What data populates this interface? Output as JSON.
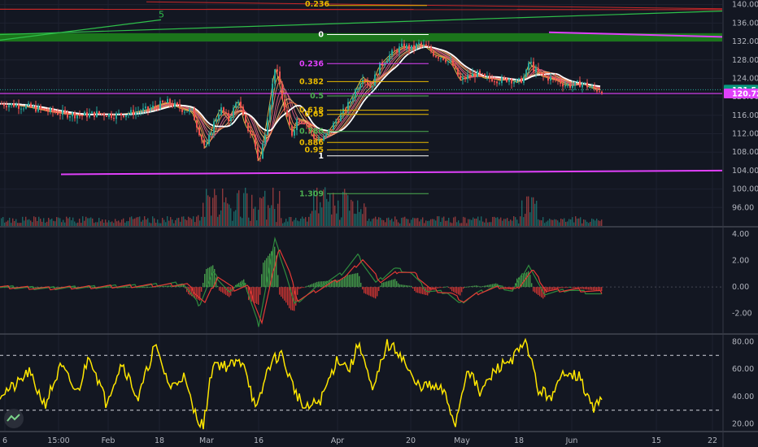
{
  "chart_data": [
    {
      "type": "candlestick",
      "title": "",
      "ylim": [
        92,
        141
      ],
      "y_ticks": [
        "140.00",
        "136.00",
        "132.00",
        "128.00",
        "124.00",
        "120.00",
        "116.00",
        "112.00",
        "108.00",
        "104.00",
        "100.00",
        "96.00"
      ],
      "price_tags": [
        {
          "value": 121.54,
          "label": "121.54",
          "color": "#089981"
        },
        {
          "value": 120.72,
          "label": "120.72",
          "color": "#e040fb"
        }
      ],
      "close_series": [
        {
          "x": 0,
          "y": 118.5
        },
        {
          "x": 20,
          "y": 118.2
        },
        {
          "x": 40,
          "y": 117.6
        },
        {
          "x": 60,
          "y": 116.8
        },
        {
          "x": 80,
          "y": 116.3
        },
        {
          "x": 100,
          "y": 116.0
        },
        {
          "x": 120,
          "y": 116.4
        },
        {
          "x": 140,
          "y": 116.0
        },
        {
          "x": 160,
          "y": 116.5
        },
        {
          "x": 180,
          "y": 117.2
        },
        {
          "x": 195,
          "y": 118.3
        },
        {
          "x": 205,
          "y": 118.8
        },
        {
          "x": 215,
          "y": 118.0
        },
        {
          "x": 225,
          "y": 117.2
        },
        {
          "x": 235,
          "y": 116.8
        },
        {
          "x": 245,
          "y": 112.0
        },
        {
          "x": 252,
          "y": 108.5
        },
        {
          "x": 260,
          "y": 113.5
        },
        {
          "x": 270,
          "y": 117.5
        },
        {
          "x": 280,
          "y": 115.0
        },
        {
          "x": 292,
          "y": 119.5
        },
        {
          "x": 300,
          "y": 114.0
        },
        {
          "x": 310,
          "y": 111.5
        },
        {
          "x": 318,
          "y": 105.5
        },
        {
          "x": 325,
          "y": 112.5
        },
        {
          "x": 332,
          "y": 120.0
        },
        {
          "x": 337,
          "y": 126.5
        },
        {
          "x": 342,
          "y": 123.5
        },
        {
          "x": 350,
          "y": 116.0
        },
        {
          "x": 358,
          "y": 112.0
        },
        {
          "x": 365,
          "y": 115.5
        },
        {
          "x": 375,
          "y": 114.5
        },
        {
          "x": 385,
          "y": 111.0
        },
        {
          "x": 395,
          "y": 110.5
        },
        {
          "x": 405,
          "y": 113.0
        },
        {
          "x": 415,
          "y": 115.5
        },
        {
          "x": 425,
          "y": 117.5
        },
        {
          "x": 435,
          "y": 121.0
        },
        {
          "x": 445,
          "y": 124.5
        },
        {
          "x": 455,
          "y": 122.0
        },
        {
          "x": 465,
          "y": 126.5
        },
        {
          "x": 475,
          "y": 128.5
        },
        {
          "x": 485,
          "y": 130.0
        },
        {
          "x": 495,
          "y": 131.0
        },
        {
          "x": 505,
          "y": 130.5
        },
        {
          "x": 515,
          "y": 131.5
        },
        {
          "x": 525,
          "y": 130.5
        },
        {
          "x": 535,
          "y": 129.0
        },
        {
          "x": 545,
          "y": 128.5
        },
        {
          "x": 555,
          "y": 127.0
        },
        {
          "x": 565,
          "y": 123.5
        },
        {
          "x": 575,
          "y": 124.5
        },
        {
          "x": 585,
          "y": 125.0
        },
        {
          "x": 595,
          "y": 124.0
        },
        {
          "x": 605,
          "y": 124.0
        },
        {
          "x": 615,
          "y": 123.5
        },
        {
          "x": 625,
          "y": 124.0
        },
        {
          "x": 635,
          "y": 123.0
        },
        {
          "x": 645,
          "y": 124.5
        },
        {
          "x": 650,
          "y": 128.0
        },
        {
          "x": 655,
          "y": 126.0
        },
        {
          "x": 665,
          "y": 124.5
        },
        {
          "x": 675,
          "y": 124.0
        },
        {
          "x": 685,
          "y": 123.5
        },
        {
          "x": 695,
          "y": 122.5
        },
        {
          "x": 705,
          "y": 122.5
        },
        {
          "x": 715,
          "y": 123.0
        },
        {
          "x": 725,
          "y": 122.0
        },
        {
          "x": 735,
          "y": 121.5
        },
        {
          "x": 740,
          "y": 121.5
        }
      ],
      "fib_levels": [
        {
          "label": "0",
          "value": 133.5,
          "color": "#ffffff"
        },
        {
          "label": "0.236",
          "value": 127.2,
          "color": "#e040fb"
        },
        {
          "label": "0.382",
          "value": 123.3,
          "color": "#e6b800"
        },
        {
          "label": "0.5",
          "value": 120.2,
          "color": "#4caf50"
        },
        {
          "label": "0.618",
          "value": 117.1,
          "color": "#e6b800"
        },
        {
          "label": "0.65",
          "value": 116.2,
          "color": "#e6b800"
        },
        {
          "label": "0.786",
          "value": 112.5,
          "color": "#4caf50"
        },
        {
          "label": "0.886",
          "value": 110.1,
          "color": "#e6b800"
        },
        {
          "label": "0.95",
          "value": 108.5,
          "color": "#e6b800"
        },
        {
          "label": "1",
          "value": 107.2,
          "color": "#ffffff"
        },
        {
          "label": "1.309",
          "value": 99.0,
          "color": "#4caf50"
        }
      ],
      "top_fib_label": "0.236",
      "wave_label": "5"
    },
    {
      "type": "line",
      "title": "",
      "ylim": [
        -3.5,
        4.5
      ],
      "y_ticks": [
        "4.00",
        "2.00",
        "0.00",
        "-2.00"
      ],
      "series": [
        {
          "values": [
            {
              "x": 0,
              "y": 0.0
            },
            {
              "x": 60,
              "y": -0.1
            },
            {
              "x": 120,
              "y": 0.0
            },
            {
              "x": 180,
              "y": 0.1
            },
            {
              "x": 225,
              "y": 0.3
            },
            {
              "x": 245,
              "y": -1.4
            },
            {
              "x": 262,
              "y": 1.1
            },
            {
              "x": 282,
              "y": -0.4
            },
            {
              "x": 300,
              "y": 0.4
            },
            {
              "x": 318,
              "y": -2.9
            },
            {
              "x": 338,
              "y": 3.6
            },
            {
              "x": 352,
              "y": 0.9
            },
            {
              "x": 362,
              "y": -1.3
            },
            {
              "x": 390,
              "y": 0.0
            },
            {
              "x": 420,
              "y": 1.0
            },
            {
              "x": 440,
              "y": 2.4
            },
            {
              "x": 462,
              "y": 0.3
            },
            {
              "x": 485,
              "y": 1.4
            },
            {
              "x": 505,
              "y": 1.1
            },
            {
              "x": 525,
              "y": -0.3
            },
            {
              "x": 550,
              "y": -0.4
            },
            {
              "x": 565,
              "y": -1.3
            },
            {
              "x": 585,
              "y": -0.5
            },
            {
              "x": 610,
              "y": 0.1
            },
            {
              "x": 630,
              "y": -0.3
            },
            {
              "x": 650,
              "y": 1.7
            },
            {
              "x": 668,
              "y": -0.5
            },
            {
              "x": 700,
              "y": -0.2
            },
            {
              "x": 740,
              "y": -0.6
            }
          ]
        },
        {
          "values": [
            {
              "x": 0,
              "y": 0.0
            },
            {
              "x": 60,
              "y": -0.1
            },
            {
              "x": 120,
              "y": 0.0
            },
            {
              "x": 180,
              "y": 0.1
            },
            {
              "x": 230,
              "y": 0.2
            },
            {
              "x": 252,
              "y": -1.2
            },
            {
              "x": 268,
              "y": 0.8
            },
            {
              "x": 288,
              "y": -0.2
            },
            {
              "x": 305,
              "y": 0.1
            },
            {
              "x": 322,
              "y": -2.7
            },
            {
              "x": 343,
              "y": 3.0
            },
            {
              "x": 356,
              "y": 1.1
            },
            {
              "x": 366,
              "y": -1.0
            },
            {
              "x": 395,
              "y": -0.1
            },
            {
              "x": 425,
              "y": 0.8
            },
            {
              "x": 446,
              "y": 2.1
            },
            {
              "x": 468,
              "y": 0.4
            },
            {
              "x": 490,
              "y": 1.2
            },
            {
              "x": 510,
              "y": 1.0
            },
            {
              "x": 530,
              "y": -0.2
            },
            {
              "x": 555,
              "y": -0.5
            },
            {
              "x": 570,
              "y": -1.1
            },
            {
              "x": 590,
              "y": -0.4
            },
            {
              "x": 615,
              "y": 0.0
            },
            {
              "x": 635,
              "y": -0.2
            },
            {
              "x": 655,
              "y": 1.3
            },
            {
              "x": 672,
              "y": -0.3
            },
            {
              "x": 705,
              "y": -0.2
            },
            {
              "x": 740,
              "y": -0.4
            }
          ]
        }
      ]
    },
    {
      "type": "line",
      "title": "",
      "ylim": [
        15,
        85
      ],
      "y_ticks": [
        "80.00",
        "60.00",
        "40.00",
        "20.00"
      ],
      "series": [
        {
          "values": [
            {
              "x": 0,
              "y": 42
            },
            {
              "x": 20,
              "y": 48
            },
            {
              "x": 35,
              "y": 58
            },
            {
              "x": 55,
              "y": 34
            },
            {
              "x": 75,
              "y": 62
            },
            {
              "x": 95,
              "y": 42
            },
            {
              "x": 110,
              "y": 71
            },
            {
              "x": 130,
              "y": 36
            },
            {
              "x": 150,
              "y": 65
            },
            {
              "x": 170,
              "y": 38
            },
            {
              "x": 190,
              "y": 77
            },
            {
              "x": 210,
              "y": 46
            },
            {
              "x": 225,
              "y": 56
            },
            {
              "x": 238,
              "y": 30
            },
            {
              "x": 250,
              "y": 18
            },
            {
              "x": 262,
              "y": 65
            },
            {
              "x": 280,
              "y": 62
            },
            {
              "x": 300,
              "y": 66
            },
            {
              "x": 315,
              "y": 28
            },
            {
              "x": 330,
              "y": 62
            },
            {
              "x": 345,
              "y": 72
            },
            {
              "x": 360,
              "y": 48
            },
            {
              "x": 375,
              "y": 30
            },
            {
              "x": 395,
              "y": 38
            },
            {
              "x": 415,
              "y": 68
            },
            {
              "x": 430,
              "y": 60
            },
            {
              "x": 442,
              "y": 80
            },
            {
              "x": 458,
              "y": 42
            },
            {
              "x": 475,
              "y": 78
            },
            {
              "x": 492,
              "y": 72
            },
            {
              "x": 510,
              "y": 49
            },
            {
              "x": 530,
              "y": 47
            },
            {
              "x": 545,
              "y": 44
            },
            {
              "x": 560,
              "y": 20
            },
            {
              "x": 575,
              "y": 62
            },
            {
              "x": 590,
              "y": 42
            },
            {
              "x": 610,
              "y": 60
            },
            {
              "x": 630,
              "y": 68
            },
            {
              "x": 648,
              "y": 79
            },
            {
              "x": 662,
              "y": 44
            },
            {
              "x": 680,
              "y": 40
            },
            {
              "x": 695,
              "y": 60
            },
            {
              "x": 712,
              "y": 54
            },
            {
              "x": 730,
              "y": 30
            },
            {
              "x": 740,
              "y": 42
            }
          ]
        }
      ],
      "levels": [
        70,
        30
      ]
    }
  ],
  "x_axis": {
    "ticks": [
      {
        "x": 6,
        "label": "6"
      },
      {
        "x": 72,
        "label": "15:00"
      },
      {
        "x": 133,
        "label": "Feb"
      },
      {
        "x": 196,
        "label": "18"
      },
      {
        "x": 254,
        "label": "Mar"
      },
      {
        "x": 318,
        "label": "16"
      },
      {
        "x": 415,
        "label": "Apr"
      },
      {
        "x": 505,
        "label": "20"
      },
      {
        "x": 568,
        "label": "May"
      },
      {
        "x": 638,
        "label": "18"
      },
      {
        "x": 703,
        "label": "Jun"
      },
      {
        "x": 807,
        "label": "15"
      },
      {
        "x": 876,
        "label": "22"
      }
    ]
  },
  "colors": {
    "background": "#131722",
    "bull": "#26a69a",
    "bear": "#ef5350",
    "macd_line": "#2e8b3e",
    "signal_line": "#e53935",
    "rsi_line": "#ffe600",
    "supply_zone": "#1b7a1b"
  }
}
